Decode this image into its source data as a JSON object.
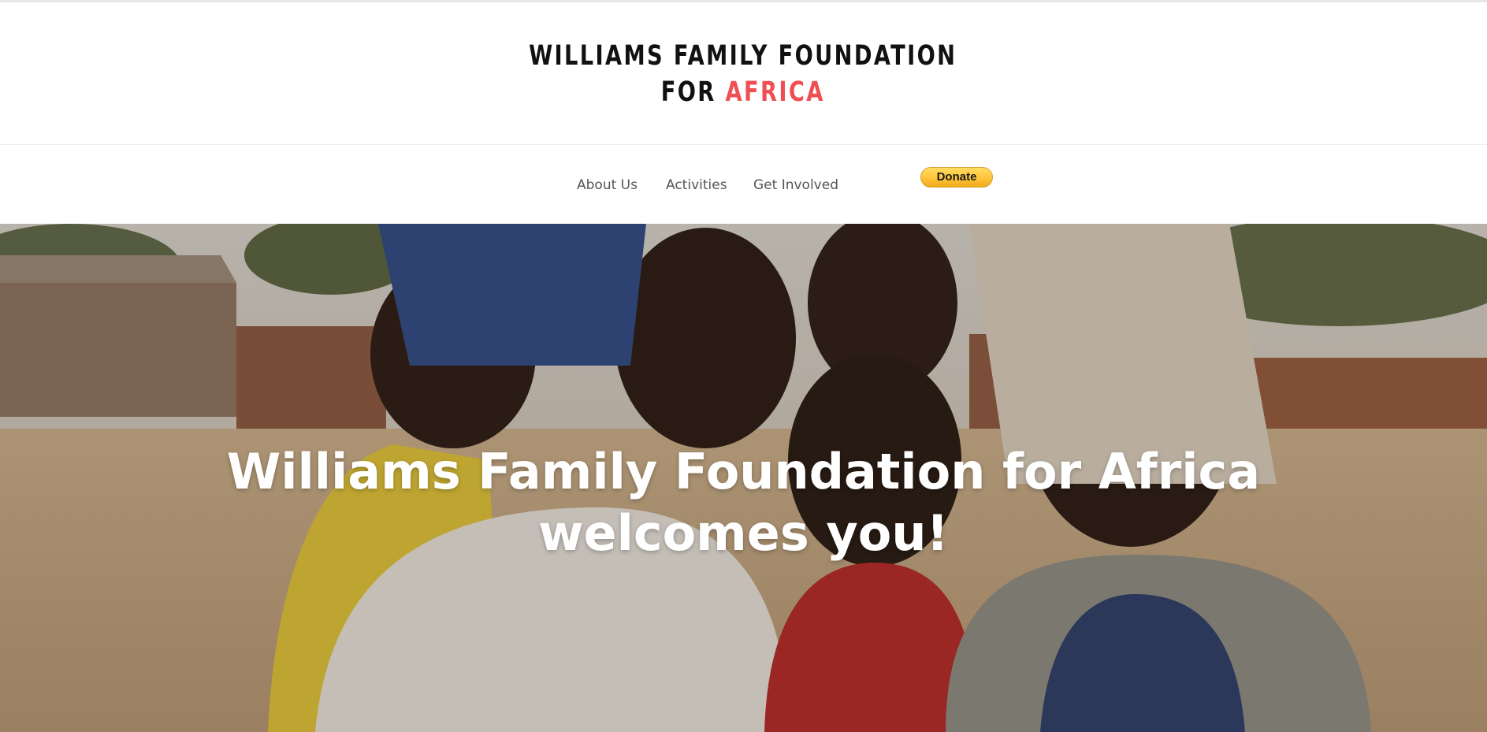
{
  "header": {
    "title_line1": "WILLIAMS FAMILY FOUNDATION",
    "title_line2_prefix": "FOR",
    "title_line2_accent": "AFRICA",
    "accent_color": "#ef4f52"
  },
  "nav": {
    "items": [
      {
        "label": "About Us"
      },
      {
        "label": "Activities"
      },
      {
        "label": "Get Involved"
      }
    ],
    "donate_label": "Donate"
  },
  "hero": {
    "heading": "Williams Family Foundation for Africa welcomes you!",
    "image_subject": "group of smiling children outdoors"
  }
}
